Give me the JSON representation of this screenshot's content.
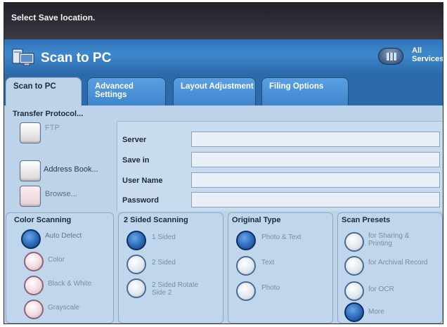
{
  "message": "Select Save location.",
  "title": "Scan to PC",
  "all_services": "All Services",
  "tabs": [
    "Scan to PC",
    "Advanced Settings",
    "Layout Adjustment",
    "Filing Options"
  ],
  "transfer": {
    "label": "Transfer Protocol...",
    "ftp": "FTP",
    "address_book": "Address Book...",
    "browse": "Browse..."
  },
  "fields": {
    "server": "Server",
    "save_in": "Save in",
    "user_name": "User Name",
    "password": "Password"
  },
  "color_scanning": {
    "title": "Color Scanning",
    "options": [
      "Auto Detect",
      "Color",
      "Black & White",
      "Grayscale"
    ],
    "selected": "Auto Detect"
  },
  "sided_scanning": {
    "title": "2 Sided Scanning",
    "options": [
      "1 Sided",
      "2 Sided",
      "2 Sided Rotate Side 2"
    ],
    "selected": "1 Sided"
  },
  "original_type": {
    "title": "Original Type",
    "options": [
      "Photo & Text",
      "Text",
      "Photo"
    ],
    "selected": "Photo & Text"
  },
  "scan_presets": {
    "title": "Scan Presets",
    "options": [
      "for Sharing & Printing",
      "for Archival Record",
      "for OCR",
      "More"
    ],
    "selected": "More"
  },
  "colors": {
    "title_bar": "#3d88cc",
    "tab_blue": "#4a92d8",
    "panel": "#bcd3ea",
    "radio_selected": "#2f6fbf"
  }
}
